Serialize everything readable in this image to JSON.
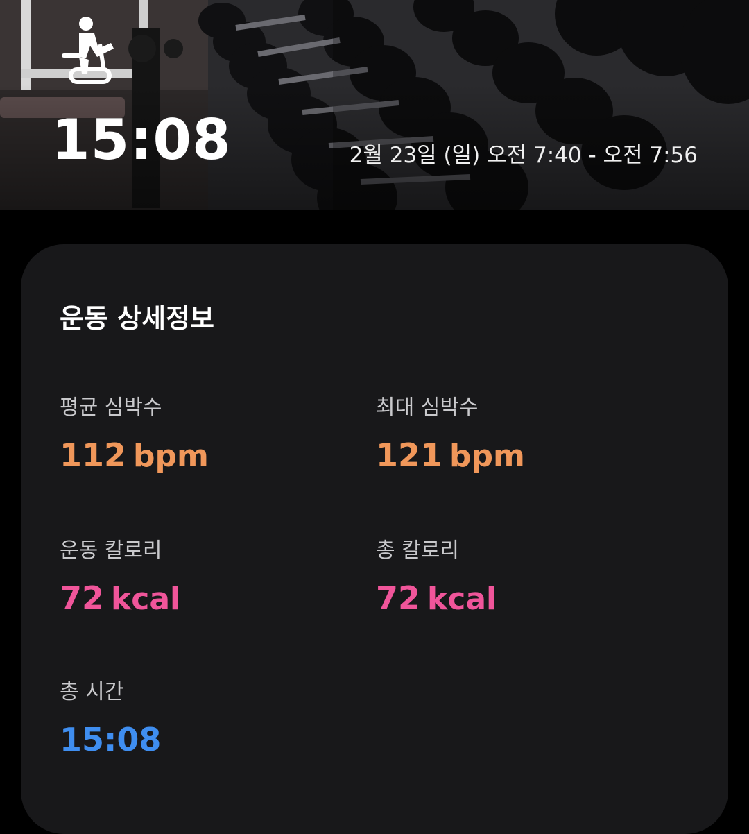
{
  "header": {
    "workout_icon": "indoor-cycle-icon",
    "duration": "15:08",
    "date_range": "2월 23일 (일) 오전 7:40 - 오전 7:56"
  },
  "details": {
    "title": "운동 상세정보",
    "metrics": [
      {
        "label": "평균 심박수",
        "value": "112",
        "unit": "bpm",
        "color": "#f0975a"
      },
      {
        "label": "최대 심박수",
        "value": "121",
        "unit": "bpm",
        "color": "#f0975a"
      },
      {
        "label": "운동 칼로리",
        "value": "72",
        "unit": "kcal",
        "color": "#f0559a"
      },
      {
        "label": "총 칼로리",
        "value": "72",
        "unit": "kcal",
        "color": "#f0559a"
      },
      {
        "label": "총 시간",
        "value": "15:08",
        "unit": "",
        "color": "#3f8ef0"
      }
    ]
  }
}
